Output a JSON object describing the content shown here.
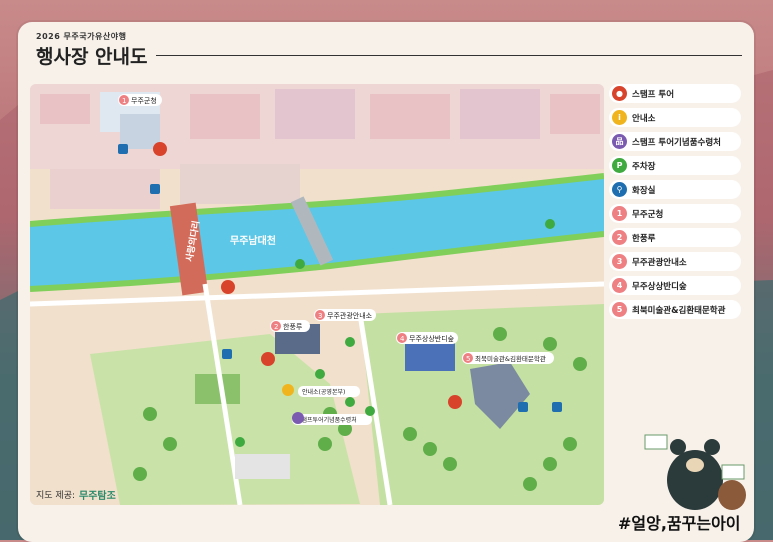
{
  "header": {
    "subtitle": "2026 무주국가유산야행",
    "title": "행사장 안내도"
  },
  "map": {
    "river_label": "무주남대천",
    "bridge_label": "사랑의다리",
    "places": [
      {
        "num": "1",
        "label": "무주군청"
      },
      {
        "num": "2",
        "label": "한풍루"
      },
      {
        "num": "3",
        "label": "무주관광안내소"
      },
      {
        "num": "4",
        "label": "무주상상반디숲"
      },
      {
        "num": "5",
        "label": "최북미술관&김환태문학관"
      }
    ],
    "info_label": "안내소(공영본부)",
    "stamp_gift_label": "스탬프투어기념품수령처"
  },
  "legend": [
    {
      "icon": "stamp-tour-icon",
      "label": "스탬프 투어",
      "color": "#d8432c",
      "glyph": "●"
    },
    {
      "icon": "info-icon",
      "label": "안내소",
      "color": "#f0b51e",
      "glyph": "i"
    },
    {
      "icon": "gift-icon",
      "label": "스탬프 투어기념품수령처",
      "color": "#7a5bb0",
      "glyph": "品"
    },
    {
      "icon": "parking-icon",
      "label": "주차장",
      "color": "#3faa3f",
      "glyph": "P"
    },
    {
      "icon": "restroom-icon",
      "label": "화장실",
      "color": "#1f6fb0",
      "glyph": "⚲"
    },
    {
      "icon": "place-1-icon",
      "label": "무주군청",
      "color": "#ee7f82",
      "glyph": "1"
    },
    {
      "icon": "place-2-icon",
      "label": "한풍루",
      "color": "#ee7f82",
      "glyph": "2"
    },
    {
      "icon": "place-3-icon",
      "label": "무주관광안내소",
      "color": "#ee7f82",
      "glyph": "3"
    },
    {
      "icon": "place-4-icon",
      "label": "무주상상반디숲",
      "color": "#ee7f82",
      "glyph": "4"
    },
    {
      "icon": "place-5-icon",
      "label": "최북미술관&김환태문학관",
      "color": "#ee7f82",
      "glyph": "5"
    }
  ],
  "credit": {
    "prefix": "지도 제공:",
    "logo": "무주탐조"
  },
  "slogan": "#얼앙,꿈꾸는아이"
}
